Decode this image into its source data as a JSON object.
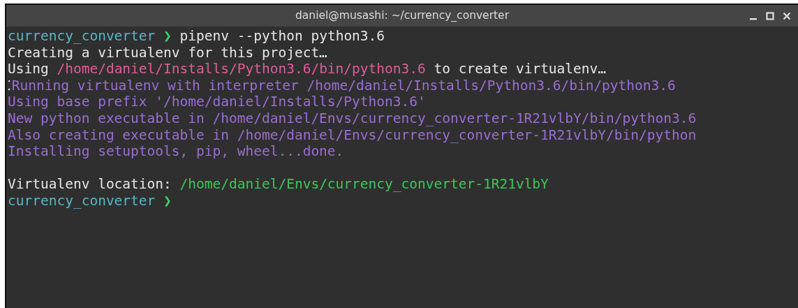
{
  "window": {
    "title": "daniel@musashi: ~/currency_converter"
  },
  "lines": [
    {
      "kind": "prompt",
      "dir": "currency_converter",
      "symbol": "❯",
      "command": "pipenv --python python3.6"
    },
    {
      "kind": "output",
      "segments": [
        {
          "kind": "plain",
          "text": "Creating a virtualenv for this project…"
        }
      ]
    },
    {
      "kind": "output",
      "segments": [
        {
          "kind": "plain",
          "text": "Using "
        },
        {
          "kind": "path",
          "text": "/home/daniel/Installs/Python3.6/bin/python3.6"
        },
        {
          "kind": "plain",
          "text": " to create virtualenv…"
        }
      ]
    },
    {
      "kind": "output",
      "segments": [
        {
          "kind": "spinner",
          "text": "⁚"
        },
        {
          "kind": "info",
          "text": "Running virtualenv with interpreter /home/daniel/Installs/Python3.6/bin/python3.6"
        }
      ]
    },
    {
      "kind": "output",
      "segments": [
        {
          "kind": "info",
          "text": "Using base prefix '/home/daniel/Installs/Python3.6'"
        }
      ]
    },
    {
      "kind": "output",
      "segments": [
        {
          "kind": "info",
          "text": "New python executable in /home/daniel/Envs/currency_converter-1R21vlbY/bin/python3.6"
        }
      ]
    },
    {
      "kind": "output",
      "segments": [
        {
          "kind": "info",
          "text": "Also creating executable in /home/daniel/Envs/currency_converter-1R21vlbY/bin/python"
        }
      ]
    },
    {
      "kind": "output",
      "segments": [
        {
          "kind": "info",
          "text": "Installing setuptools, pip, wheel...done."
        }
      ]
    },
    {
      "kind": "blank"
    },
    {
      "kind": "output",
      "segments": [
        {
          "kind": "plain",
          "text": "Virtualenv location: "
        },
        {
          "kind": "success",
          "text": "/home/daniel/Envs/currency_converter-1R21vlbY"
        }
      ]
    },
    {
      "kind": "prompt",
      "dir": "currency_converter",
      "symbol": "❯"
    }
  ]
}
